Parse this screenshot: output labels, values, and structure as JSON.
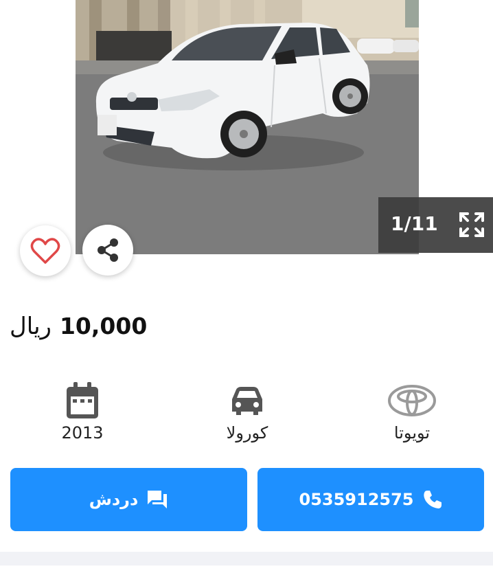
{
  "gallery": {
    "counter": "1/11"
  },
  "listing": {
    "price_amount": "10,000",
    "price_currency": "ريال"
  },
  "specs": {
    "year": "2013",
    "model": "كورولا",
    "make": "تويوتا"
  },
  "actions": {
    "chat_label": "دردش",
    "phone_number": "0535912575"
  },
  "colors": {
    "accent": "#1e90ff",
    "favorite": "#e04848",
    "counter_bg": "#3c3c3c",
    "strip": "#f1f2f6"
  },
  "icons": {
    "favorite": "heart-icon",
    "share": "share-icon",
    "expand": "expand-icon",
    "year": "calendar-icon",
    "model": "car-icon",
    "make": "toyota-logo-icon",
    "chat": "chat-icon",
    "call": "phone-icon"
  }
}
